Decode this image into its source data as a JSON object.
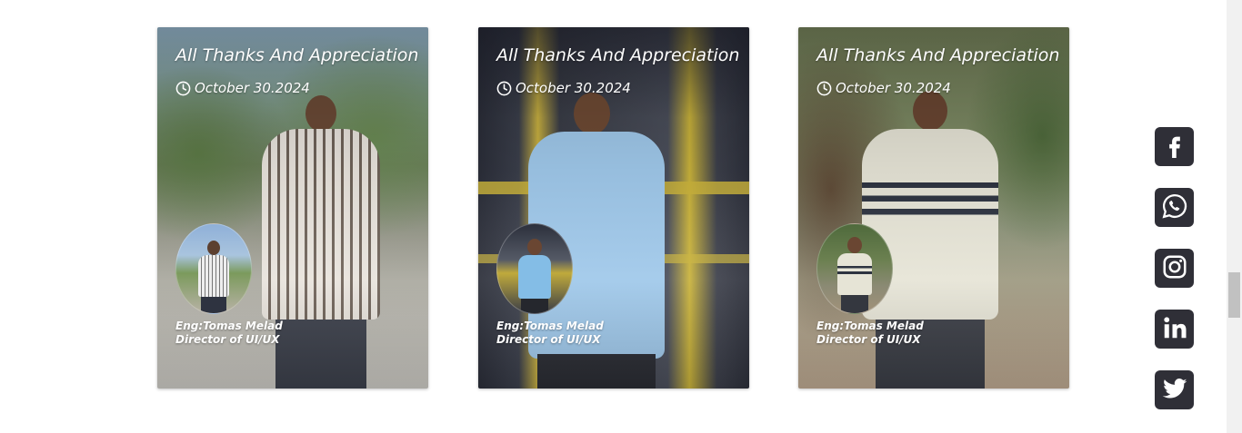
{
  "cards": [
    {
      "title": "All Thanks And Appreciation",
      "date": "October 30.2024",
      "author_name": "Eng:Tomas Melad",
      "author_role": "Director of UI/UX"
    },
    {
      "title": "All Thanks And Appreciation",
      "date": "October 30.2024",
      "author_name": "Eng:Tomas Melad",
      "author_role": "Director of UI/UX"
    },
    {
      "title": "All Thanks And Appreciation",
      "date": "October 30.2024",
      "author_name": "Eng:Tomas Melad",
      "author_role": "Director of UI/UX"
    }
  ],
  "social": [
    {
      "icon": "facebook-icon"
    },
    {
      "icon": "whatsapp-icon"
    },
    {
      "icon": "instagram-icon"
    },
    {
      "icon": "linkedin-icon"
    },
    {
      "icon": "twitter-icon"
    }
  ],
  "colors": {
    "social_bg": "#2f2f37",
    "text": "#ffffff"
  }
}
